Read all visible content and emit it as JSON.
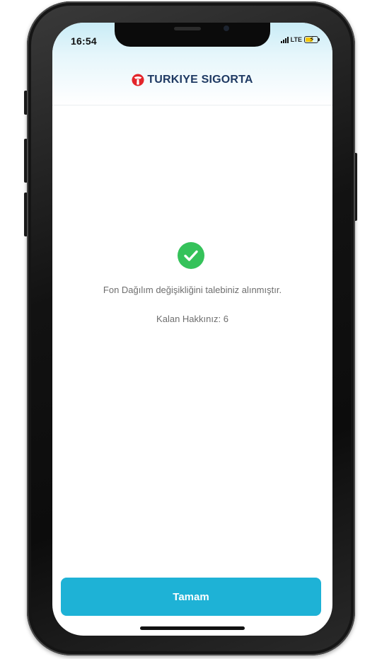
{
  "status_bar": {
    "time": "16:54",
    "network": "LTE"
  },
  "header": {
    "brand_name": "TURKIYE SIGORTA",
    "brand_color": "#1f3a63",
    "logo_color": "#e3262b"
  },
  "main": {
    "status_icon": "check-circle-icon",
    "success_color": "#35c25a",
    "message": "Fon Dağılım değişikliğini talebiniz alınmıştır.",
    "remaining": "Kalan Hakkınız: 6"
  },
  "footer": {
    "ok_label": "Tamam",
    "button_color": "#1eb2d6"
  }
}
